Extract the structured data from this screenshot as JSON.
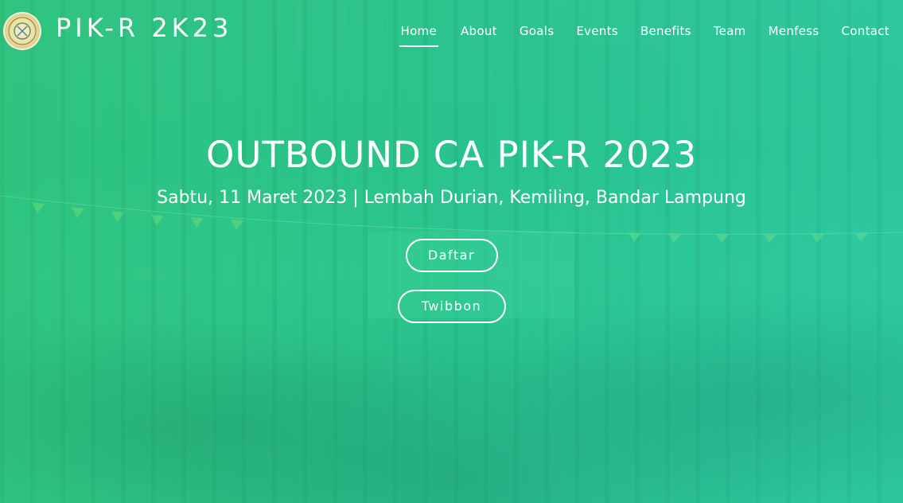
{
  "brand": {
    "title": "PIK-R 2K23",
    "logo_icon": "organization-seal-icon"
  },
  "nav": {
    "items": [
      {
        "label": "Home",
        "active": true
      },
      {
        "label": "About",
        "active": false
      },
      {
        "label": "Goals",
        "active": false
      },
      {
        "label": "Events",
        "active": false
      },
      {
        "label": "Benefits",
        "active": false
      },
      {
        "label": "Team",
        "active": false
      },
      {
        "label": "Menfess",
        "active": false
      },
      {
        "label": "Contact",
        "active": false
      }
    ]
  },
  "hero": {
    "title": "OUTBOUND CA PIK-R 2023",
    "subtitle": "Sabtu, 11 Maret 2023 | Lembah Durian, Kemiling, Bandar Lampung",
    "buttons": {
      "daftar": "Daftar",
      "twibbon": "Twibbon"
    }
  },
  "colors": {
    "overlay_green": "#2fc48a",
    "text": "#ffffff"
  }
}
